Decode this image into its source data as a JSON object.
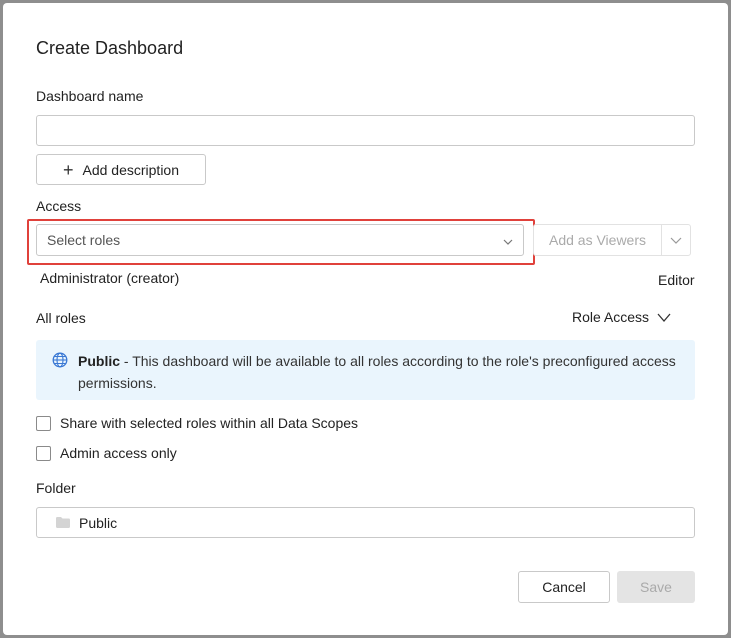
{
  "dialog": {
    "title": "Create Dashboard",
    "dashboard_name": {
      "label": "Dashboard name",
      "value": "",
      "placeholder": ""
    },
    "add_description_label": "Add description",
    "access": {
      "label": "Access",
      "select_placeholder": "Select roles",
      "add_as_viewers_label": "Add as Viewers",
      "creator_name": "Administrator (creator)",
      "creator_role": "Editor",
      "all_roles_label": "All roles",
      "role_access_label": "Role Access",
      "info": {
        "strong": "Public",
        "text": " - This dashboard will be available to all roles according to the role's preconfigured access permissions."
      }
    },
    "checkboxes": [
      {
        "label": "Share with selected roles within all Data Scopes",
        "checked": false
      },
      {
        "label": "Admin access only",
        "checked": false
      }
    ],
    "folder": {
      "label": "Folder",
      "value": "Public"
    },
    "buttons": {
      "cancel": "Cancel",
      "save": "Save"
    }
  },
  "colors": {
    "highlight": "#e0413b",
    "info_bg": "#eaf5fd",
    "globe_icon": "#3a78d4"
  },
  "icons": {
    "add": "plus-icon",
    "select": "chevron-down-icon",
    "info": "globe-icon",
    "folder": "folder-icon"
  }
}
